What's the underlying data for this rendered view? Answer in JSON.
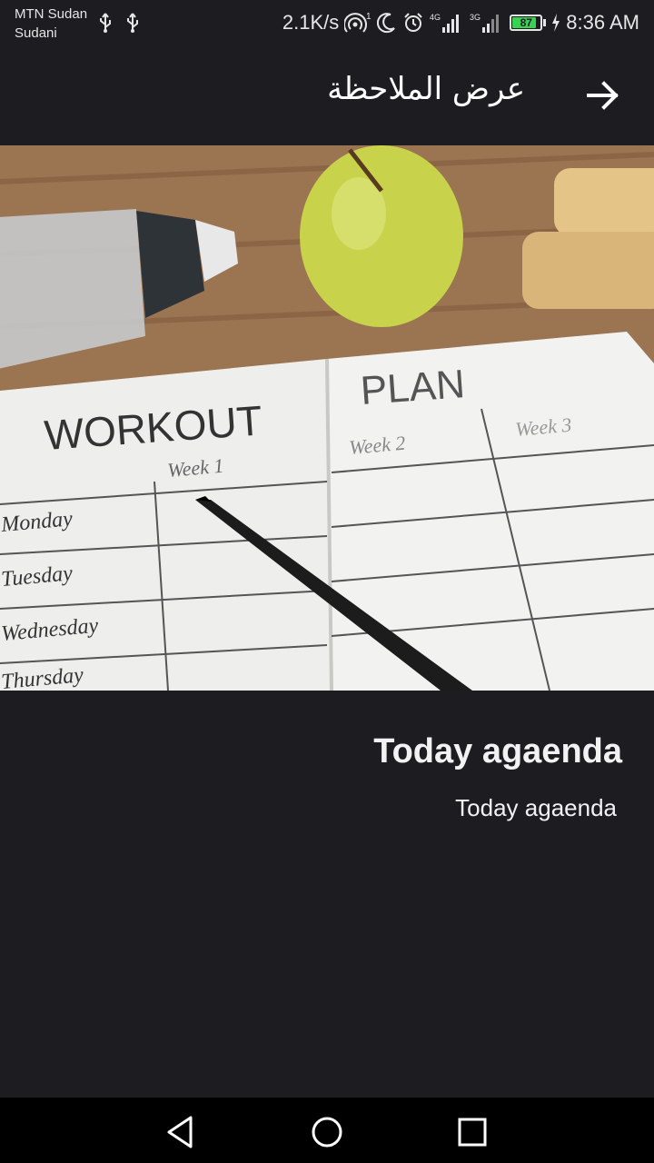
{
  "status_bar": {
    "carrier_line1": "MTN Sudan",
    "carrier_line2": "Sudani",
    "net_speed": "2.1K/s",
    "hotspot_sup": "1",
    "sig1_label": "4G",
    "sig2_label": "3G",
    "battery_level": "87",
    "time": "8:36 AM",
    "battery_color": "#39d353"
  },
  "toolbar": {
    "title": "عرض الملاحظة",
    "back_icon": "arrow-right-icon"
  },
  "hero": {
    "image_subject": "workout-plan-notebook-image",
    "notebook_heading_left": "WORKOUT",
    "notebook_heading_right": "PLAN",
    "col_week1": "Week 1",
    "col_week2": "Week 2",
    "col_week3": "Week 3",
    "days": [
      "Monday",
      "Tuesday",
      "Wednesday",
      "Thursday"
    ]
  },
  "note": {
    "title": "Today agaenda",
    "body": "Today agaenda"
  },
  "nav_bar": {
    "back_icon": "triangle-back-icon",
    "home_icon": "circle-home-icon",
    "recents_icon": "square-recents-icon"
  },
  "colors": {
    "background": "#1d1c21",
    "text": "#f2f2f2",
    "nav_background": "#000000"
  }
}
